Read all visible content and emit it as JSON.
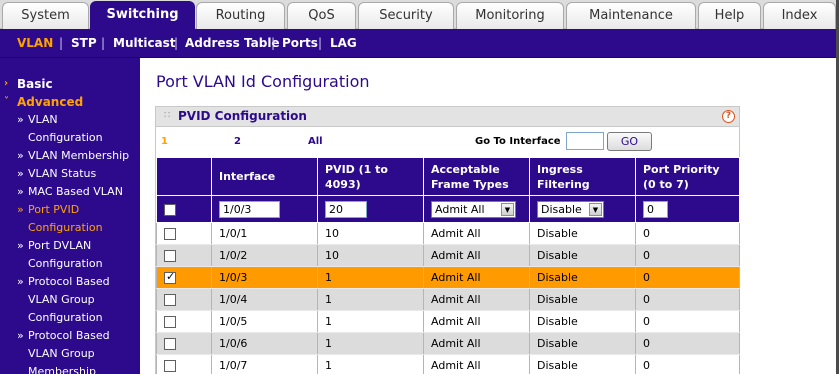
{
  "top_tabs": [
    {
      "label": "System"
    },
    {
      "label": "Switching"
    },
    {
      "label": "Routing"
    },
    {
      "label": "QoS"
    },
    {
      "label": "Security"
    },
    {
      "label": "Monitoring"
    },
    {
      "label": "Maintenance"
    },
    {
      "label": "Help"
    },
    {
      "label": "Index"
    }
  ],
  "sub_nav": [
    {
      "label": "VLAN"
    },
    {
      "label": "STP"
    },
    {
      "label": "Multicast"
    },
    {
      "label": "Address Table"
    },
    {
      "label": "Ports"
    },
    {
      "label": "LAG"
    }
  ],
  "sub_sep": "|",
  "sidebar": {
    "basic": "Basic",
    "advanced": "Advanced",
    "bullet": "»",
    "arrow_collapsed": "›",
    "arrow_expanded": "˅",
    "items": [
      {
        "lines": [
          "VLAN",
          "Configuration"
        ]
      },
      {
        "lines": [
          "VLAN Membership"
        ]
      },
      {
        "lines": [
          "VLAN Status"
        ]
      },
      {
        "lines": [
          "MAC Based VLAN"
        ]
      },
      {
        "lines": [
          "Port PVID",
          "Configuration"
        ]
      },
      {
        "lines": [
          "Port DVLAN",
          "Configuration"
        ]
      },
      {
        "lines": [
          "Protocol Based",
          "VLAN Group",
          "Configuration"
        ]
      },
      {
        "lines": [
          "Protocol Based",
          "VLAN Group",
          "Membership"
        ]
      }
    ]
  },
  "page_title": "Port VLAN Id Configuration",
  "panel": {
    "title": "PVID Configuration",
    "help": "?"
  },
  "pager": {
    "pages": [
      "1",
      "2",
      "All"
    ],
    "goto_label": "Go To Interface",
    "goto_value": "",
    "go_button": "GO"
  },
  "table": {
    "headers": [
      "",
      "Interface",
      "PVID (1 to 4093)",
      "Acceptable Frame Types",
      "Ingress Filtering",
      "Port Priority (0 to 7)"
    ],
    "edit_row": {
      "interface": "1/0/3",
      "pvid": "20",
      "frame_types": "Admit All",
      "ingress": "Disable",
      "priority": "0"
    },
    "rows": [
      {
        "interface": "1/0/1",
        "pvid": "10",
        "frame_types": "Admit All",
        "ingress": "Disable",
        "priority": "0"
      },
      {
        "interface": "1/0/2",
        "pvid": "10",
        "frame_types": "Admit All",
        "ingress": "Disable",
        "priority": "0"
      },
      {
        "interface": "1/0/3",
        "pvid": "1",
        "frame_types": "Admit All",
        "ingress": "Disable",
        "priority": "0"
      },
      {
        "interface": "1/0/4",
        "pvid": "1",
        "frame_types": "Admit All",
        "ingress": "Disable",
        "priority": "0"
      },
      {
        "interface": "1/0/5",
        "pvid": "1",
        "frame_types": "Admit All",
        "ingress": "Disable",
        "priority": "0"
      },
      {
        "interface": "1/0/6",
        "pvid": "1",
        "frame_types": "Admit All",
        "ingress": "Disable",
        "priority": "0"
      },
      {
        "interface": "1/0/7",
        "pvid": "1",
        "frame_types": "Admit All",
        "ingress": "Disable",
        "priority": "0"
      }
    ]
  },
  "colors": {
    "brand": "#2d0a8c",
    "accent": "#ffa200",
    "selected_row": "#ff9a00"
  }
}
